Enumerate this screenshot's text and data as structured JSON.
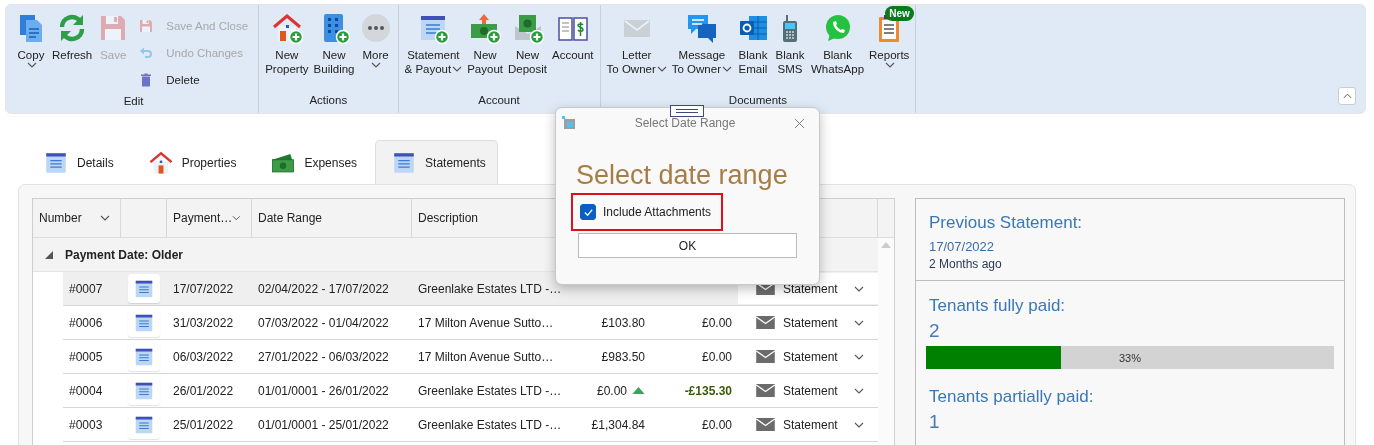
{
  "ribbon": {
    "groups": [
      {
        "label": "Edit",
        "items": [
          {
            "kind": "large",
            "label": "Copy",
            "dropdown": true,
            "disabled": false
          },
          {
            "kind": "large",
            "label": "Refresh",
            "disabled": false
          },
          {
            "kind": "large",
            "label": "Save",
            "disabled": true
          },
          {
            "kind": "stack",
            "items": [
              {
                "label": "Save And Close",
                "disabled": true
              },
              {
                "label": "Undo Changes",
                "disabled": true
              },
              {
                "label": "Delete",
                "disabled": false
              }
            ]
          }
        ]
      },
      {
        "label": "Actions",
        "items": [
          {
            "kind": "large",
            "label": "New\nProperty",
            "disabled": false
          },
          {
            "kind": "large",
            "label": "New\nBuilding",
            "disabled": false
          },
          {
            "kind": "large",
            "label": "More",
            "dropdown": true,
            "disabled": false
          }
        ]
      },
      {
        "label": "Account",
        "items": [
          {
            "kind": "large",
            "label": "Statement\n& Payout",
            "dropdown": true,
            "disabled": false
          },
          {
            "kind": "large",
            "label": "New\nPayout",
            "disabled": false
          },
          {
            "kind": "large",
            "label": "New\nDeposit",
            "disabled": false
          },
          {
            "kind": "large",
            "label": "Account",
            "disabled": false
          }
        ]
      },
      {
        "label": "Documents",
        "items": [
          {
            "kind": "large",
            "label": "Letter\nTo Owner",
            "dropdown": true,
            "disabled": false
          },
          {
            "kind": "large",
            "label": "Message\nTo Owner",
            "dropdown": true,
            "disabled": false
          },
          {
            "kind": "large",
            "label": "Blank\nEmail",
            "disabled": false
          },
          {
            "kind": "large",
            "label": "Blank\nSMS",
            "disabled": false
          },
          {
            "kind": "large",
            "label": "Blank\nWhatsApp",
            "disabled": false
          },
          {
            "kind": "large",
            "label": "Reports",
            "dropdown": true,
            "badge": "New",
            "disabled": false
          }
        ]
      }
    ]
  },
  "tabs": [
    {
      "label": "Details",
      "selected": false
    },
    {
      "label": "Properties",
      "selected": false
    },
    {
      "label": "Expenses",
      "selected": false
    },
    {
      "label": "Statements",
      "selected": true
    }
  ],
  "table": {
    "columns": [
      {
        "label": "Number",
        "filter": true
      },
      {
        "label": "Payment…",
        "filter": true
      },
      {
        "label": "Date Range"
      },
      {
        "label": "Description"
      }
    ],
    "group": {
      "label": "Payment Date: Older",
      "expanded": true
    },
    "rows": [
      {
        "number": "#0007",
        "payment_date": "17/07/2022",
        "date_range": "02/04/2022 - 17/07/2022",
        "description": "Greenlake Estates LTD -…",
        "document": "Statement",
        "selected": true,
        "flagged": false
      },
      {
        "number": "#0006",
        "payment_date": "31/03/2022",
        "date_range": "07/03/2022 - 01/04/2022",
        "description": "17 Milton Avenue Sutto…",
        "amount": "£103.80",
        "balance": "£0.00",
        "document": "Statement",
        "selected": false,
        "flagged": false
      },
      {
        "number": "#0005",
        "payment_date": "06/03/2022",
        "date_range": "27/01/2022 - 06/03/2022",
        "description": "17 Milton Avenue Sutto…",
        "amount": "£983.50",
        "balance": "£0.00",
        "document": "Statement",
        "selected": false,
        "flagged": false
      },
      {
        "number": "#0004",
        "payment_date": "26/01/2022",
        "date_range": "01/01/0001 - 26/01/2022",
        "description": "Greenlake Estates LTD -…",
        "amount": "£0.00",
        "balance": "-£135.30",
        "document": "Statement",
        "selected": false,
        "flagged": true
      },
      {
        "number": "#0003",
        "payment_date": "25/01/2022",
        "date_range": "01/01/0001 - 25/01/2022",
        "description": "Greenlake Estates LTD -…",
        "amount": "£1,304.84",
        "balance": "£0.00",
        "document": "Statement",
        "selected": false,
        "flagged": false
      }
    ]
  },
  "summary": {
    "previous": {
      "title": "Previous Statement:",
      "date": "17/07/2022",
      "ago": "2 Months ago"
    },
    "stats": [
      {
        "title": "Tenants fully paid:",
        "value": "2",
        "level": 0.33,
        "percent": "33%"
      },
      {
        "title": "Tenants partially paid:",
        "value": "1"
      }
    ]
  },
  "dialog": {
    "title": "Select Date Range",
    "heading": "Select date range",
    "checkbox": {
      "label": "Include Attachments",
      "checked": true,
      "highlighted": true
    },
    "button": "OK"
  }
}
